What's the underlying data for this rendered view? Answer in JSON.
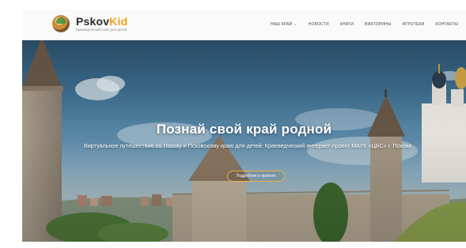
{
  "logo": {
    "title_part1": "Pskov",
    "title_part2": "Kid",
    "subtitle": "Краеведческий сайт для детей"
  },
  "nav": {
    "items": [
      {
        "label": "НАШ КРАЙ",
        "has_dropdown": true
      },
      {
        "label": "НОВОСТИ"
      },
      {
        "label": "КНИГИ"
      },
      {
        "label": "ВИКТОРИНЫ"
      },
      {
        "label": "ИГРОТЕКИ"
      },
      {
        "label": "КОНТАКТЫ"
      }
    ]
  },
  "hero": {
    "title": "Познай свой край родной",
    "subtitle": "Виртуальное путешествие по Пскову и Псковскому краю для детей. Краеведческий интернет-проект МАУК «ЦБС» г. Пскова",
    "button_label": "Подробнее о проекте"
  },
  "colors": {
    "accent": "#f2a018",
    "button_border": "#f0b03a",
    "header_bg": "#fafafa"
  },
  "icons": {
    "logo": "kremlin-logo-icon",
    "dropdown": "chevron-down-icon"
  }
}
